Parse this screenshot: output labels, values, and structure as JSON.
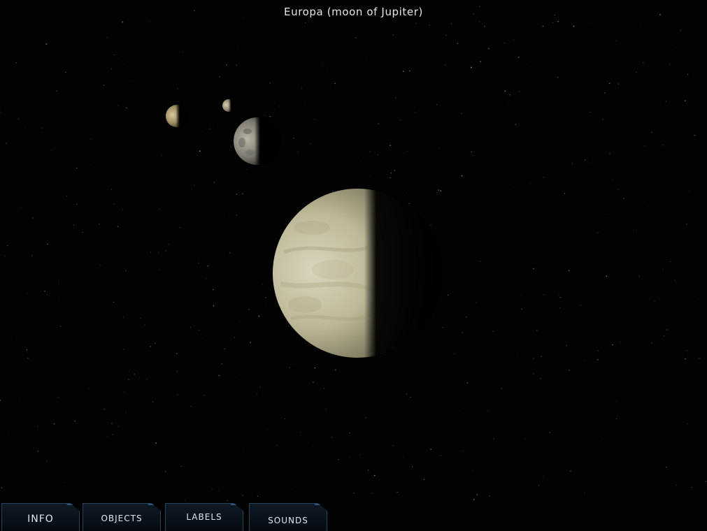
{
  "title": "Europa (moon of Jupiter)",
  "tabs": [
    {
      "label": "INFO"
    },
    {
      "label": "OBJECTS"
    },
    {
      "label": "LABELS"
    },
    {
      "label": "SOUNDS"
    }
  ],
  "colors": {
    "space_background": "#020203",
    "europa_surface": "#c9c5a8",
    "tab_border": "#27425d",
    "tab_text": "#dfe6ee"
  }
}
